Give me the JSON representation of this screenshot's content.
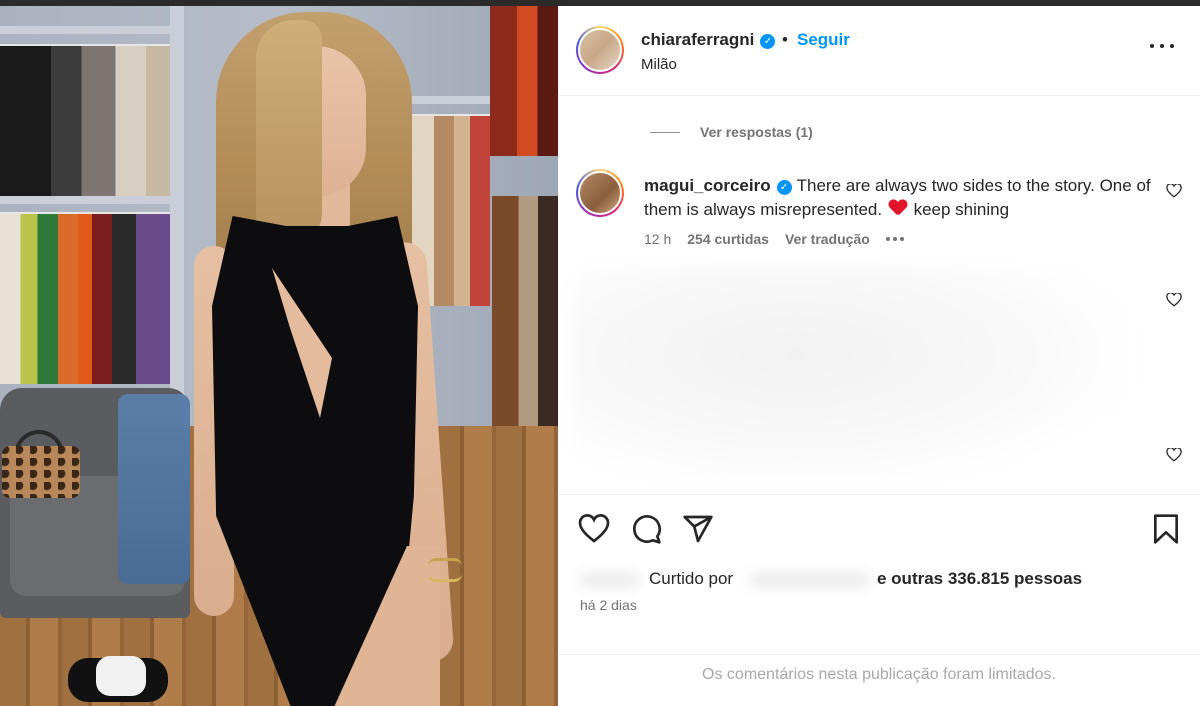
{
  "post": {
    "author": "chiaraferragni",
    "author_verified": true,
    "separator": "•",
    "follow_label": "Seguir",
    "location": "Milão"
  },
  "comments_section": {
    "view_replies": "Ver respostas (1)",
    "comment": {
      "user": "magui_corceiro",
      "verified": true,
      "text_before_emoji": "There are always two sides to the story. One of them is always misrepresented.",
      "emoji": "red-heart",
      "text_after_emoji": "keep shining",
      "time": "12 h",
      "likes": "254 curtidas",
      "translate": "Ver tradução"
    }
  },
  "actions": {
    "icons": [
      "heart-icon",
      "comment-icon",
      "share-icon",
      "bookmark-icon"
    ],
    "liked_by_label": "Curtido por",
    "liked_others": "e outras 336.815 pessoas",
    "timestamp": "há 2 dias"
  },
  "footer": {
    "comments_limited": "Os comentários nesta publicação foram limitados."
  },
  "colors": {
    "accent_blue": "#0095f6",
    "text_primary": "#262626",
    "text_secondary": "#737373",
    "heart_red": "#e0142a"
  }
}
